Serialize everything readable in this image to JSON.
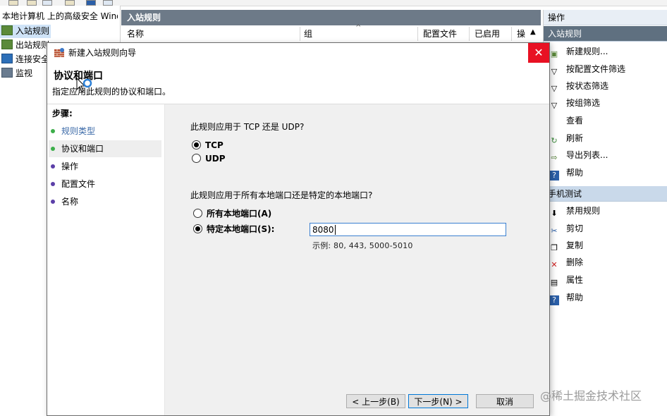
{
  "tree": {
    "root": "本地计算机 上的高级安全 Windows",
    "items": [
      {
        "label": "入站规则"
      },
      {
        "label": "出站规则"
      },
      {
        "label": "连接安全"
      },
      {
        "label": "监视"
      }
    ]
  },
  "center": {
    "title": "入站规则",
    "columns": [
      "名称",
      "组",
      "配置文件",
      "已启用",
      "操"
    ]
  },
  "actions": {
    "header": "操作",
    "section1": {
      "title": "入站规则",
      "items": [
        {
          "label": "新建规则...",
          "icon": "new-rule-icon"
        },
        {
          "label": "按配置文件筛选",
          "icon": "filter-icon"
        },
        {
          "label": "按状态筛选",
          "icon": "filter-icon"
        },
        {
          "label": "按组筛选",
          "icon": "filter-icon"
        },
        {
          "label": "查看",
          "icon": "view-icon"
        },
        {
          "label": "刷新",
          "icon": "refresh-icon"
        },
        {
          "label": "导出列表...",
          "icon": "export-icon"
        },
        {
          "label": "帮助",
          "icon": "help-icon"
        }
      ]
    },
    "section2": {
      "title": "手机测试",
      "items": [
        {
          "label": "禁用规则",
          "icon": "disable-icon"
        },
        {
          "label": "剪切",
          "icon": "cut-icon"
        },
        {
          "label": "复制",
          "icon": "copy-icon"
        },
        {
          "label": "删除",
          "icon": "delete-icon"
        },
        {
          "label": "属性",
          "icon": "properties-icon"
        },
        {
          "label": "帮助",
          "icon": "help-icon"
        }
      ]
    }
  },
  "wizard": {
    "title": "新建入站规则向导",
    "close": "✕",
    "header_title": "协议和端口",
    "header_subtitle": "指定应用此规则的协议和端口。",
    "steps_title": "步骤:",
    "steps": [
      {
        "label": "规则类型",
        "state": "done"
      },
      {
        "label": "协议和端口",
        "state": "current"
      },
      {
        "label": "操作",
        "state": "pending"
      },
      {
        "label": "配置文件",
        "state": "pending"
      },
      {
        "label": "名称",
        "state": "pending"
      }
    ],
    "question_protocol": "此规则应用于 TCP 还是 UDP?",
    "protocols": [
      {
        "label": "TCP",
        "selected": true
      },
      {
        "label": "UDP",
        "selected": false
      }
    ],
    "question_ports": "此规则应用于所有本地端口还是特定的本地端口?",
    "ports_all": "所有本地端口(A)",
    "ports_specific": "特定本地端口(S):",
    "ports_selected": "specific",
    "port_value": "8080",
    "port_example": "示例: 80, 443, 5000-5010",
    "buttons": {
      "back": "< 上一步(B)",
      "next": "下一步(N) >",
      "cancel": "取消"
    }
  },
  "watermark": "@稀土掘金技术社区",
  "colors": {
    "dot_done": "#3cae4a",
    "dot_pending": "#5b3fa8",
    "close_red": "#e81123",
    "header_dark": "#6d7a88"
  }
}
